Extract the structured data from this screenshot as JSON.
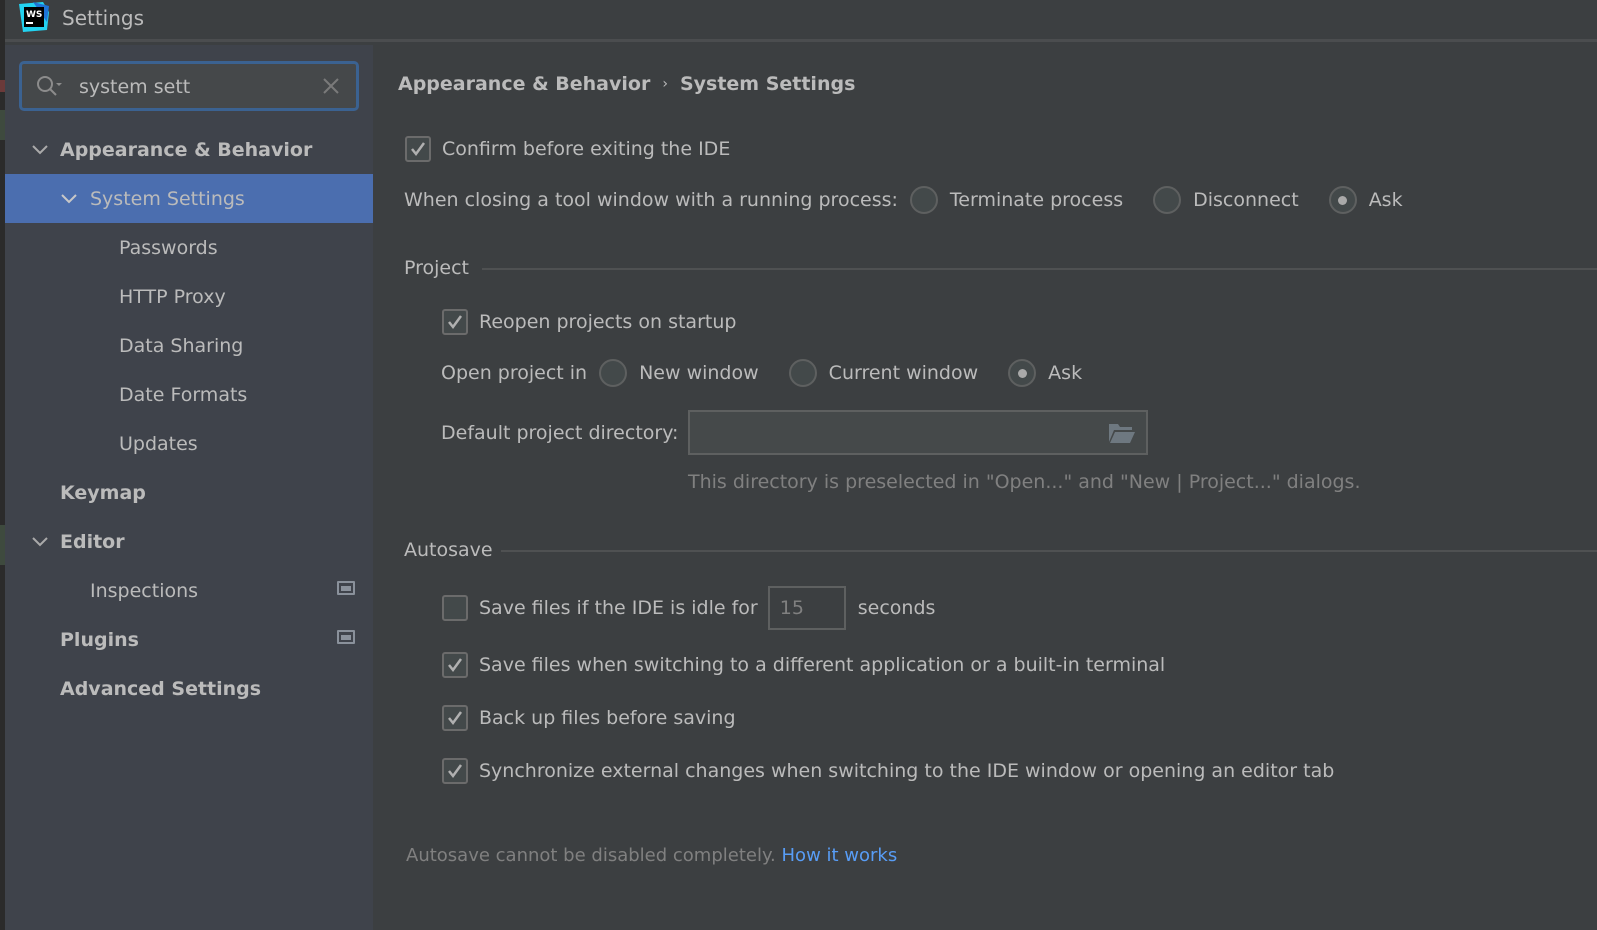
{
  "window": {
    "title": "Settings",
    "app_logo_text": "WS"
  },
  "search": {
    "value": "system sett",
    "placeholder": ""
  },
  "sidebar": {
    "items": [
      {
        "label": "Appearance & Behavior",
        "level": 0,
        "bold": true,
        "expanded": true
      },
      {
        "label": "System Settings",
        "level": 1,
        "bold": false,
        "expanded": true,
        "selected": true
      },
      {
        "label": "Passwords",
        "level": 2
      },
      {
        "label": "HTTP Proxy",
        "level": 2
      },
      {
        "label": "Data Sharing",
        "level": 2
      },
      {
        "label": "Date Formats",
        "level": 2
      },
      {
        "label": "Updates",
        "level": 2
      },
      {
        "label": "Keymap",
        "level": 0,
        "bold": true
      },
      {
        "label": "Editor",
        "level": 0,
        "bold": true,
        "expanded": true
      },
      {
        "label": "Inspections",
        "level": 1,
        "badge": "project-scope-icon"
      },
      {
        "label": "Plugins",
        "level": 0,
        "bold": true,
        "badge": "project-scope-icon"
      },
      {
        "label": "Advanced Settings",
        "level": 0,
        "bold": true
      }
    ]
  },
  "breadcrumb": {
    "parent": "Appearance & Behavior",
    "separator": "›",
    "current": "System Settings"
  },
  "general": {
    "confirm_exit": {
      "label": "Confirm before exiting the IDE",
      "checked": true
    },
    "closing_tool_window": {
      "label": "When closing a tool window with a running process:",
      "options": [
        "Terminate process",
        "Disconnect",
        "Ask"
      ],
      "selected": "Ask"
    }
  },
  "project": {
    "title": "Project",
    "reopen": {
      "label": "Reopen projects on startup",
      "checked": true
    },
    "open_in": {
      "label": "Open project in",
      "options": [
        "New window",
        "Current window",
        "Ask"
      ],
      "selected": "Ask"
    },
    "default_dir": {
      "label": "Default project directory:",
      "value": "",
      "hint": "This directory is preselected in \"Open...\" and \"New | Project...\" dialogs."
    }
  },
  "autosave": {
    "title": "Autosave",
    "idle": {
      "label": "Save files if the IDE is idle for",
      "checked": false,
      "seconds": "15",
      "unit": "seconds"
    },
    "on_switch": {
      "label": "Save files when switching to a different application or a built-in terminal",
      "checked": true
    },
    "backup": {
      "label": "Back up files before saving",
      "checked": true
    },
    "sync": {
      "label": "Synchronize external changes when switching to the IDE window or opening an editor tab",
      "checked": true
    },
    "note": "Autosave cannot be disabled completely.",
    "link": "How it works"
  },
  "colors": {
    "accent": "#4b6eaf",
    "link": "#589df6",
    "focus": "#3b6291"
  }
}
